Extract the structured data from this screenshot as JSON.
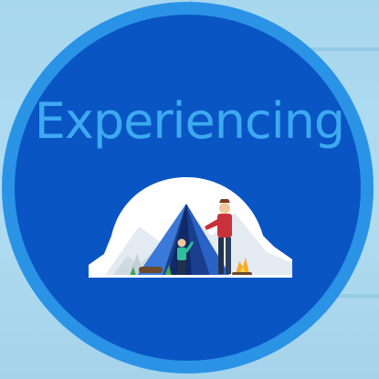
{
  "badge": {
    "title": "Experiencing"
  },
  "illustration": {
    "icon": "camping-tent-scene-icon"
  },
  "colors": {
    "ring": "#2b93e6",
    "badge_fill": "#0a55c4",
    "title_text": "#3da9f1",
    "background": "#a9d8ef"
  }
}
